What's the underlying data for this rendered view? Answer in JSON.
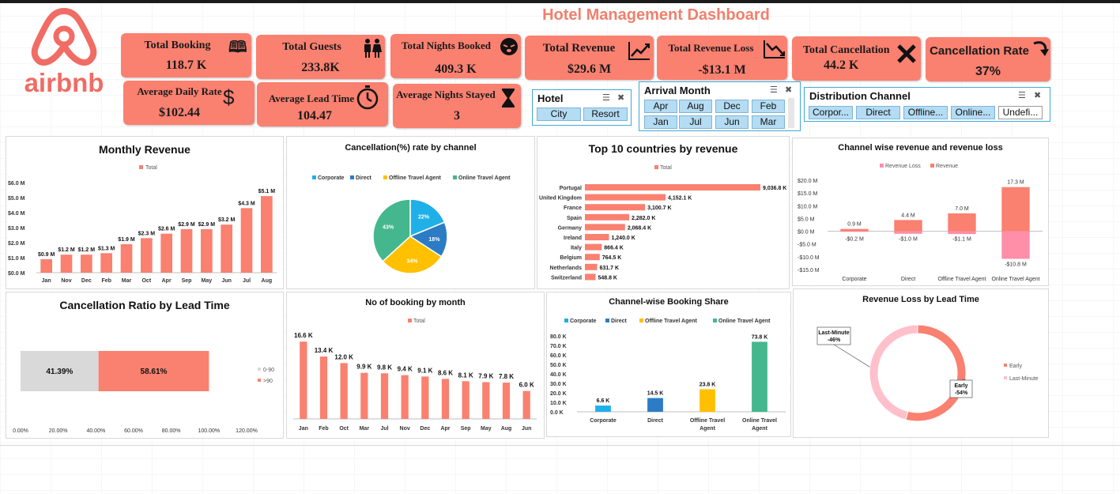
{
  "dashboard": {
    "title": "Hotel Management Dashboard",
    "logo_text": "airbnb",
    "colors": {
      "accent": "#fa8070",
      "title": "#f0806d",
      "logo": "#f06c64",
      "slicer": "#b4dcf3"
    }
  },
  "kpis": {
    "total_booking": {
      "label": "Total Booking",
      "value": "118.7 K",
      "icon": "book-icon"
    },
    "total_guests": {
      "label": "Total Guests",
      "value": "233.8K",
      "icon": "people-icon"
    },
    "total_nights": {
      "label": "Total Nights Booked",
      "value": "409.3 K",
      "icon": "sleep-face-icon"
    },
    "total_revenue": {
      "label": "Total Revenue",
      "value": "$29.6 M",
      "icon": "trend-up-icon"
    },
    "total_revenue_loss": {
      "label": "Total Revenue Loss",
      "value": "-$13.1 M",
      "icon": "trend-down-icon"
    },
    "total_cancellation": {
      "label": "Total Cancellation",
      "value": "44.2 K",
      "icon": "x-icon"
    },
    "cancellation_rate": {
      "label": "Cancellation Rate",
      "value": "37%",
      "icon": "curved-arrow-icon"
    },
    "avg_daily_rate": {
      "label": "Average Daily Rate",
      "value": "$102.44",
      "icon": "dollar-icon"
    },
    "avg_lead_time": {
      "label": "Average Lead Time",
      "value": "104.47",
      "icon": "stopwatch-icon"
    },
    "avg_nights": {
      "label": "Average Nights Stayed",
      "value": "3",
      "icon": "hourglass-icon"
    }
  },
  "slicers": {
    "hotel": {
      "title": "Hotel",
      "items": [
        "City",
        "Resort"
      ]
    },
    "month": {
      "title": "Arrival Month",
      "items": [
        "Apr",
        "Aug",
        "Dec",
        "Feb",
        "Jan",
        "Jul",
        "Jun",
        "Mar"
      ]
    },
    "channel": {
      "title": "Distribution Channel",
      "items": [
        "Corpor...",
        "Direct",
        "Offline...",
        "Online...",
        "Undefi..."
      ]
    }
  },
  "chart_data": [
    {
      "id": "monthly_revenue",
      "type": "bar",
      "title": "Monthly Revenue",
      "legend": [
        "Total"
      ],
      "categories": [
        "Jan",
        "Nov",
        "Dec",
        "Feb",
        "Mar",
        "Oct",
        "Apr",
        "Sep",
        "May",
        "Jun",
        "Jul",
        "Aug"
      ],
      "values": [
        0.9,
        1.2,
        1.2,
        1.3,
        1.9,
        2.3,
        2.6,
        2.9,
        2.9,
        3.2,
        4.3,
        5.1
      ],
      "labels": [
        "$0.9 M",
        "$1.2 M",
        "$1.2 M",
        "$1.3 M",
        "$1.9 M",
        "$2.3 M",
        "$2.6 M",
        "$2.9 M",
        "$2.9 M",
        "$3.2 M",
        "$4.3 M",
        "$5.1 M"
      ],
      "ylim": [
        0,
        6
      ],
      "yticks": [
        0,
        1,
        2,
        3,
        4,
        5,
        6
      ],
      "ytick_labels": [
        "$0.0 M",
        "$1.0 M",
        "$2.0 M",
        "$3.0 M",
        "$4.0 M",
        "$5.0 M",
        "$6.0 M"
      ]
    },
    {
      "id": "cancel_by_channel",
      "type": "pie",
      "title": "Cancellation(%) rate by channel",
      "legend": [
        "Corporate",
        "Direct",
        "Offline Travel Agent",
        "Online Travel Agent"
      ],
      "values": [
        22,
        18,
        34,
        43
      ],
      "labels": [
        "22%",
        "18%",
        "34%",
        "43%"
      ],
      "colors": [
        "#1fb0e8",
        "#2b7cc4",
        "#ffc000",
        "#45b78e"
      ]
    },
    {
      "id": "top_countries",
      "type": "bar",
      "orientation": "horizontal",
      "title": "Top 10 countries by revenue",
      "legend": [
        "Total"
      ],
      "categories": [
        "Portugal",
        "United Kingdom",
        "France",
        "Spain",
        "Germany",
        "Ireland",
        "Italy",
        "Belgium",
        "Netherlands",
        "Switzerland"
      ],
      "values": [
        9036.8,
        4152.1,
        3100.7,
        2282.0,
        2068.4,
        1240.0,
        866.4,
        764.5,
        631.7,
        548.8
      ],
      "labels": [
        "9,036.8 K",
        "4,152.1 K",
        "3,100.7 K",
        "2,282.0 K",
        "2,068.4 K",
        "1,240.0 K",
        "866.4 K",
        "764.5 K",
        "631.7 K",
        "548.8 K"
      ]
    },
    {
      "id": "channel_rev",
      "type": "bar",
      "title": "Channel wise revenue and revenue loss",
      "categories": [
        "Corporate",
        "Direct",
        "Offline Travel Agent",
        "Online Travel Agent"
      ],
      "series": [
        {
          "name": "Revenue Loss",
          "values": [
            -0.2,
            -1.0,
            -1.1,
            -10.8
          ],
          "labels": [
            "-$0.2 M",
            "-$1.0 M",
            "-$1.1 M",
            "-$10.8 M"
          ],
          "color": "#ff8fa8"
        },
        {
          "name": "Revenue",
          "values": [
            0.9,
            4.4,
            7.0,
            17.3
          ],
          "labels": [
            "0.9 M",
            "4.4 M",
            "7.0 M",
            "17.3 M"
          ],
          "color": "#fa8070"
        }
      ],
      "ylim": [
        -15,
        20
      ],
      "yticks": [
        -15,
        -10,
        -5,
        0,
        5,
        10,
        15,
        20
      ],
      "ytick_labels": [
        "-$15.0 M",
        "-$10.0 M",
        "-$5.0 M",
        "$0.0 M",
        "$5.0 M",
        "$10.0 M",
        "$15.0 M",
        "$20.0 M"
      ]
    },
    {
      "id": "cancel_lead",
      "type": "bar",
      "orientation": "stacked-horizontal",
      "title": "Cancellation Ratio by Lead Time",
      "series": [
        {
          "name": "0-90",
          "value": 41.39,
          "label": "41.39%",
          "color": "#d9d9d9"
        },
        {
          "name": ">90",
          "value": 58.61,
          "label": "58.61%",
          "color": "#fa8070"
        }
      ],
      "xlim": [
        0,
        120
      ],
      "xticks": [
        0,
        20,
        40,
        60,
        80,
        100,
        120
      ],
      "xtick_labels": [
        "0.00%",
        "20.00%",
        "40.00%",
        "60.00%",
        "80.00%",
        "100.00%",
        "120.00%"
      ]
    },
    {
      "id": "booking_month",
      "type": "bar",
      "title": "No of booking by month",
      "legend": [
        "Total"
      ],
      "categories": [
        "Jan",
        "Feb",
        "Oct",
        "Mar",
        "Jul",
        "Nov",
        "Dec",
        "Apr",
        "Sep",
        "May",
        "Aug",
        "Jun"
      ],
      "values": [
        16.6,
        13.4,
        12.0,
        9.9,
        9.8,
        9.4,
        9.1,
        8.6,
        8.1,
        7.9,
        7.8,
        6.0
      ],
      "labels": [
        "16.6 K",
        "13.4 K",
        "12.0 K",
        "9.9 K",
        "9.8 K",
        "9.4 K",
        "9.1 K",
        "8.6 K",
        "8.1 K",
        "7.9 K",
        "7.8 K",
        "6.0 K"
      ],
      "ylim": [
        0,
        18
      ]
    },
    {
      "id": "channel_share",
      "type": "bar",
      "title": "Channel-wise Booking Share",
      "legend": [
        "Corporate",
        "Direct",
        "Offline Travel Agent",
        "Online Travel Agent"
      ],
      "categories": [
        "Corporate",
        "Direct",
        "Offline Travel Agent",
        "Online Travel Agent"
      ],
      "values": [
        6.6,
        14.5,
        23.8,
        73.8
      ],
      "labels": [
        "6.6 K",
        "14.5 K",
        "23.8 K",
        "73.8 K"
      ],
      "colors": [
        "#1fb0e8",
        "#2b7cc4",
        "#ffc000",
        "#45b78e"
      ],
      "ylim": [
        0,
        80
      ],
      "yticks": [
        0,
        10,
        20,
        30,
        40,
        50,
        60,
        70,
        80
      ],
      "ytick_labels": [
        "0.0 K",
        "10.0 K",
        "20.0 K",
        "30.0 K",
        "40.0 K",
        "50.0 K",
        "60.0 K",
        "70.0 K",
        "80.0 K"
      ]
    },
    {
      "id": "loss_lead",
      "type": "pie",
      "subtype": "donut",
      "title": "Revenue Loss by Lead Time",
      "legend": [
        "Early",
        "Last-Minute"
      ],
      "values": [
        54,
        46
      ],
      "callouts": [
        [
          "Early",
          "-54%"
        ],
        [
          "Last-Minute",
          "-46%"
        ]
      ],
      "colors": [
        "#fa8070",
        "#ffc0cb"
      ]
    }
  ]
}
